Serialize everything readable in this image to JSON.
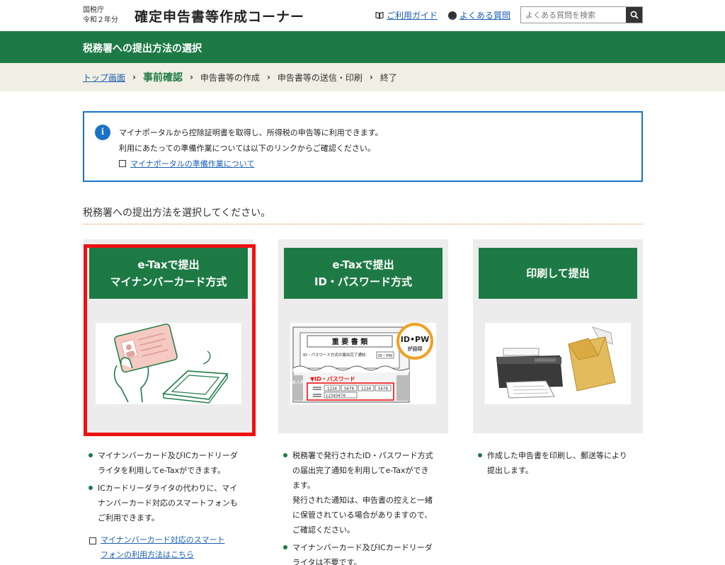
{
  "header": {
    "agency_line1": "国税庁",
    "agency_line2": "令和２年分",
    "site_title": "確定申告書等作成コーナー",
    "guide_link": "ご利用ガイド",
    "faq_link": "よくある質問",
    "search_placeholder": "よくある質問を検索"
  },
  "titlebar": {
    "title": "税務署への提出方法の選択"
  },
  "breadcrumb": {
    "items": [
      "トップ画面",
      "事前確認",
      "申告書等の作成",
      "申告書等の送信・印刷",
      "終了"
    ]
  },
  "info": {
    "line1": "マイナポータルから控除証明書を取得し、所得税の申告等に利用できます。",
    "line2": "利用にあたっての準備作業については以下のリンクからご確認ください。",
    "link": "マイナポータルの準備作業について"
  },
  "prompt": "税務署への提出方法を選択してください。",
  "cards": [
    {
      "title_line1": "e-Taxで提出",
      "title_line2": "マイナンバーカード方式",
      "bullets": [
        [
          "マイナンバーカード及びICカードリーダ",
          "ライタを利用してe-Taxができます。"
        ],
        [
          "ICカードリーダライタの代わりに、マイ",
          "ナンバーカード対応のスマートフォンも",
          "ご利用できます。"
        ]
      ],
      "link_line1": "マイナンバーカード対応のスマート",
      "link_line2": "フォンの利用方法はこちら"
    },
    {
      "title_line1": "e-Taxで提出",
      "title_line2": "ID・パスワード方式",
      "image_text": {
        "doc_title": "重 要 書 類",
        "doc_sub": "ID・パスワード方式の届出完了通知",
        "badge_small": "ID・PW",
        "badge_line1": "ID•PW",
        "badge_line2": "が目印",
        "pw_label": "▼ID・パスワード",
        "cells": [
          "1234",
          "5678",
          "1234",
          "5678"
        ],
        "cell_small": "12345678",
        "side": "本人用"
      },
      "bullets": [
        [
          "税務署で発行されたID・パスワード方式",
          "の届出完了通知を利用してe-Taxができ",
          "ます。",
          "発行された通知は、申告書の控えと一緒",
          "に保管されている場合がありますので、",
          "ご確認ください。"
        ],
        [
          "マイナンバーカード及びICカードリーダ",
          "ライタは不要です。"
        ]
      ]
    },
    {
      "title_line1": "印刷して提出",
      "bullets": [
        [
          "作成した申告書を印刷し、郵送等により",
          "提出します。"
        ]
      ]
    }
  ],
  "colors": {
    "brand_green": "#1e7a45",
    "info_blue": "#1a73c7",
    "selected_red": "#ee1111",
    "link": "#1a5fb4"
  }
}
